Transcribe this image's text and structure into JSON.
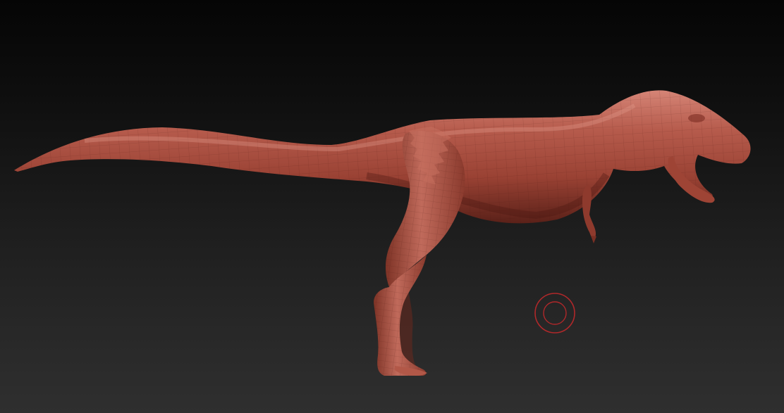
{
  "canvas": {
    "background_top": "#050505",
    "background_bottom": "#2f2f2f",
    "model": {
      "subject": "theropod-dinosaur-sculpt",
      "material_color": "#a84a3b",
      "shade_color": "#5e2219",
      "highlight_color": "#d9867a",
      "wireframe_visible": true
    },
    "brush_cursor": {
      "icon": "brush-circle-icon",
      "color": "#b0282a"
    }
  }
}
